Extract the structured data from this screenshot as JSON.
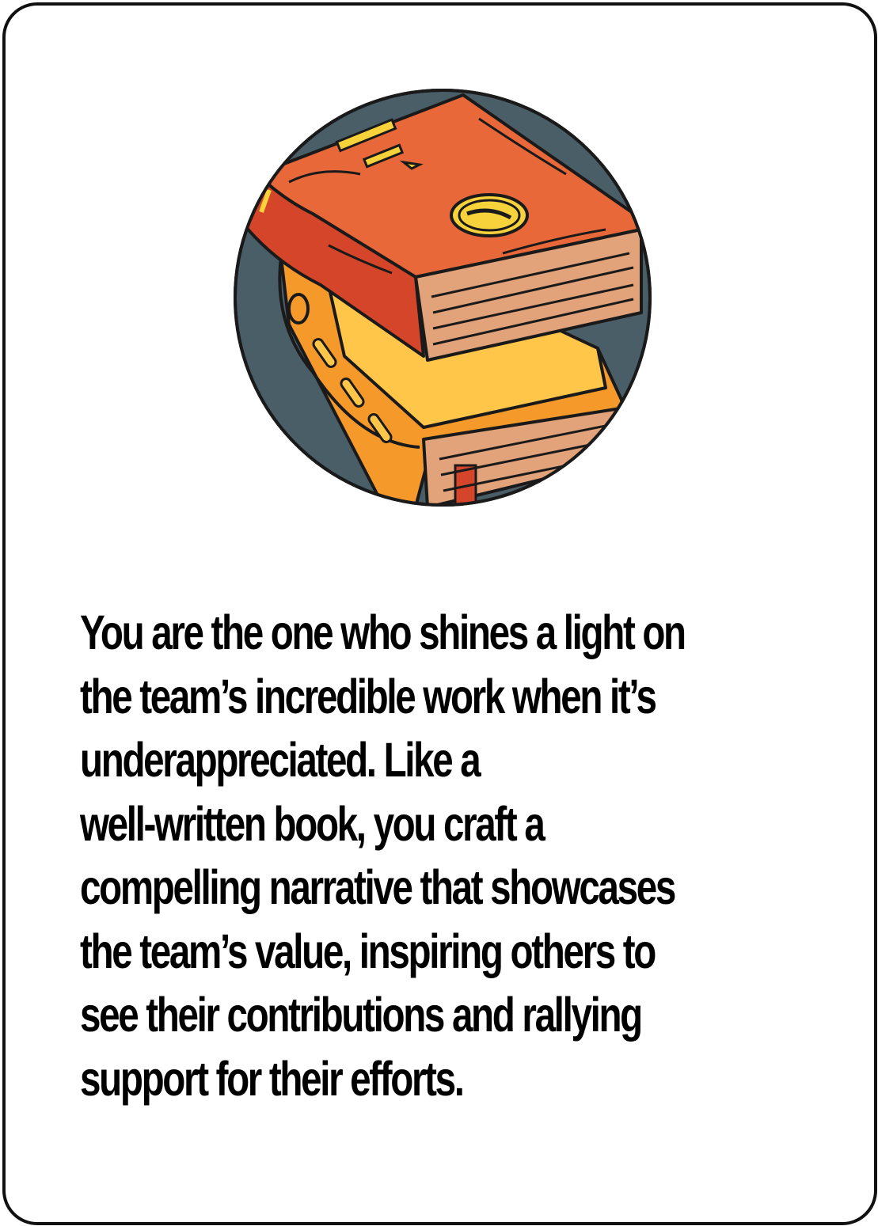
{
  "card": {
    "illustration": {
      "icon": "book-stack-icon",
      "colors": {
        "circle_background": "#4a5e68",
        "top_book_cover": "#d4452a",
        "top_book_highlight": "#e8683a",
        "bottom_book_cover": "#f59a2a",
        "bottom_book_highlight": "#ffc64a",
        "pages": "#e2a27a",
        "emblem": "#f7d23a",
        "outline": "#1a1a1a"
      }
    },
    "text_lines": [
      "You are the one who shines a light on",
      "the team’s incredible work when it’s",
      "underappreciated. Like a",
      "well-written book, you craft a",
      "compelling narrative that showcases",
      "the team’s value, inspiring others to",
      "see their contributions and rallying",
      "support for their efforts."
    ]
  }
}
